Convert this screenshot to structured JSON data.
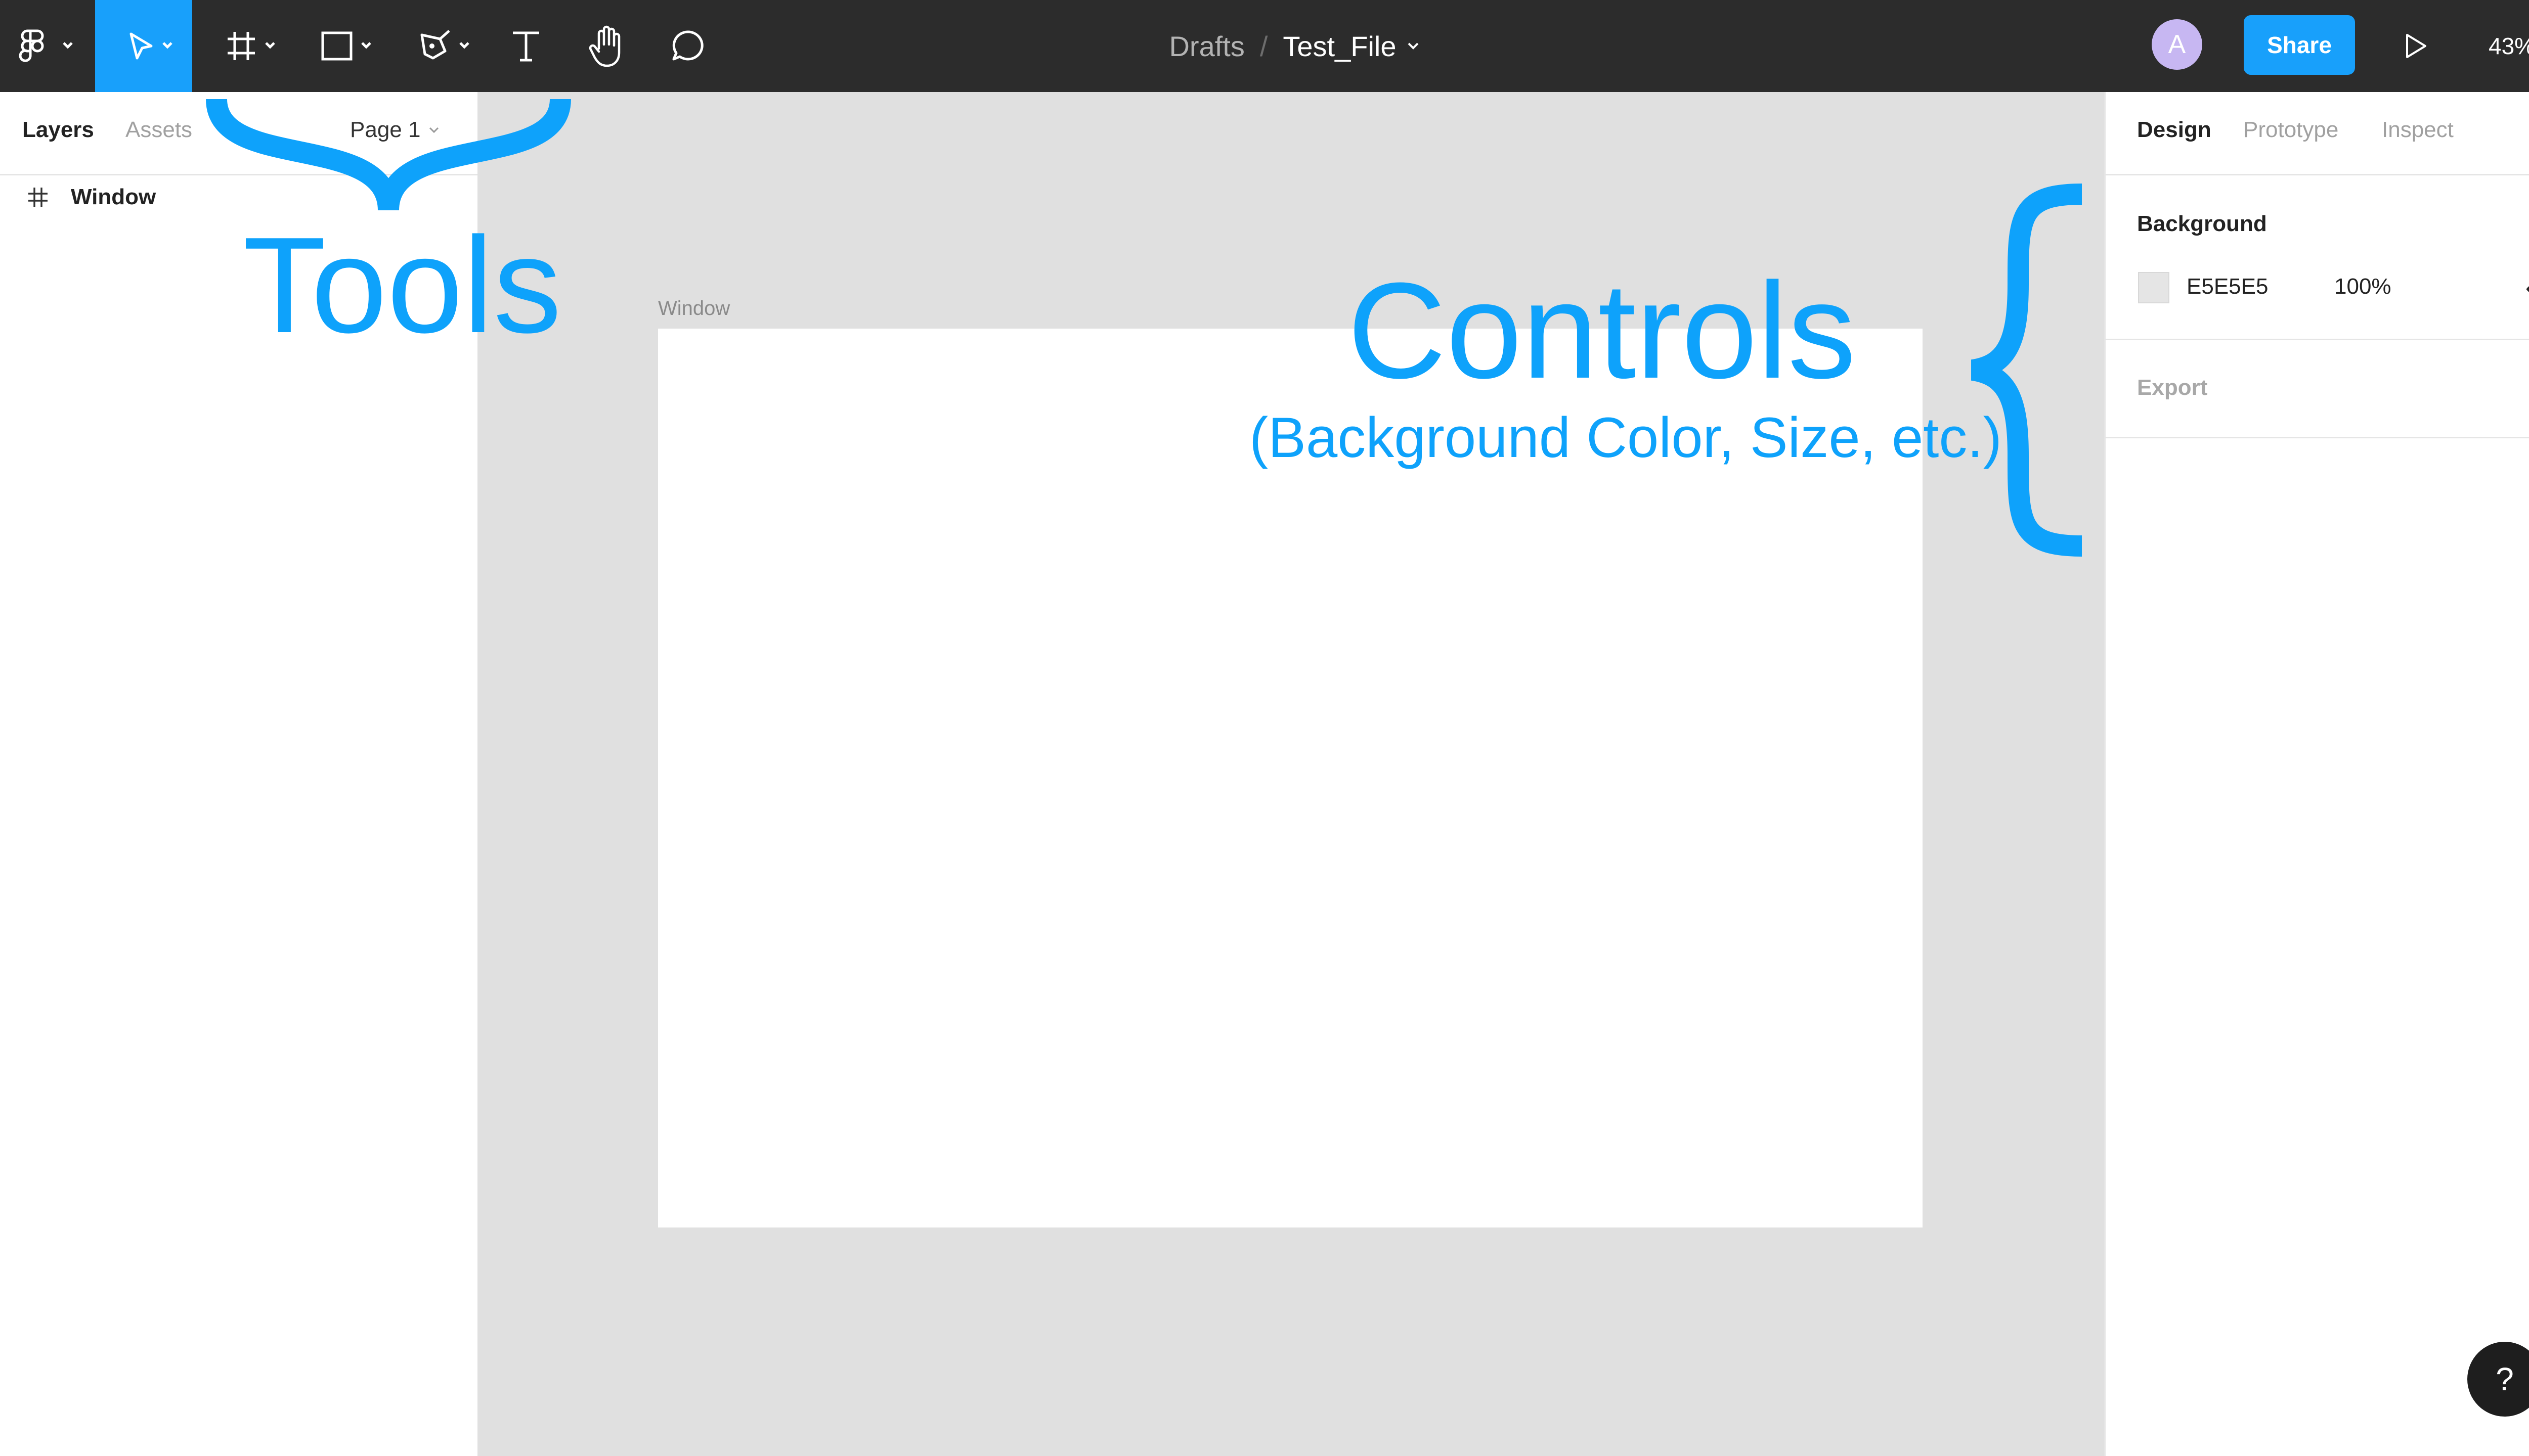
{
  "toolbar": {
    "breadcrumb_parent": "Drafts",
    "breadcrumb_separator": "/",
    "file_name": "Test_File",
    "avatar_initial": "A",
    "share_label": "Share",
    "zoom_level": "43%",
    "tools": [
      "figma-menu-icon",
      "move-icon",
      "frame-icon",
      "rectangle-icon",
      "pen-icon",
      "text-icon",
      "hand-icon",
      "comment-icon"
    ]
  },
  "left_panel": {
    "tabs": [
      "Layers",
      "Assets"
    ],
    "active_tab": "Layers",
    "page_selector": "Page 1",
    "layers": [
      {
        "name": "Window",
        "icon": "frame-icon"
      }
    ]
  },
  "canvas": {
    "frame_label": "Window",
    "background": "#e0e0e0"
  },
  "right_panel": {
    "tabs": [
      "Design",
      "Prototype",
      "Inspect"
    ],
    "active_tab": "Design",
    "background_section": {
      "title": "Background",
      "color_hex": "E5E5E5",
      "opacity": "100%"
    },
    "export_section": {
      "title": "Export"
    }
  },
  "annotations": {
    "tools": "Tools",
    "controls": "Controls",
    "controls_sub": "(Background Color, Size, etc.)",
    "color": "#0ea2fb"
  },
  "help_label": "?",
  "colors": {
    "toolbar_bg": "#2c2c2c",
    "accent": "#18a0fb",
    "avatar": "#c7b7f2"
  }
}
